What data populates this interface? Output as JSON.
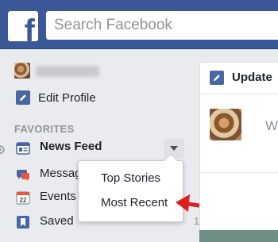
{
  "header": {
    "logo_letter": "f",
    "search_placeholder": "Search Facebook"
  },
  "sidebar": {
    "edit_profile": "Edit Profile",
    "favorites_heading": "FAVORITES",
    "items": [
      {
        "label": "News Feed",
        "icon": "news-feed-icon"
      },
      {
        "label": "Messages",
        "icon": "messages-icon"
      },
      {
        "label": "Events",
        "icon": "events-icon",
        "icon_text": "22"
      },
      {
        "label": "Saved",
        "icon": "saved-icon",
        "count": "1"
      }
    ]
  },
  "dropdown": {
    "options": [
      "Top Stories",
      "Most Recent"
    ]
  },
  "composer": {
    "title": "Update",
    "prompt": "W"
  },
  "colors": {
    "brand_blue": "#3b5998",
    "annotation_red": "#e02020"
  }
}
